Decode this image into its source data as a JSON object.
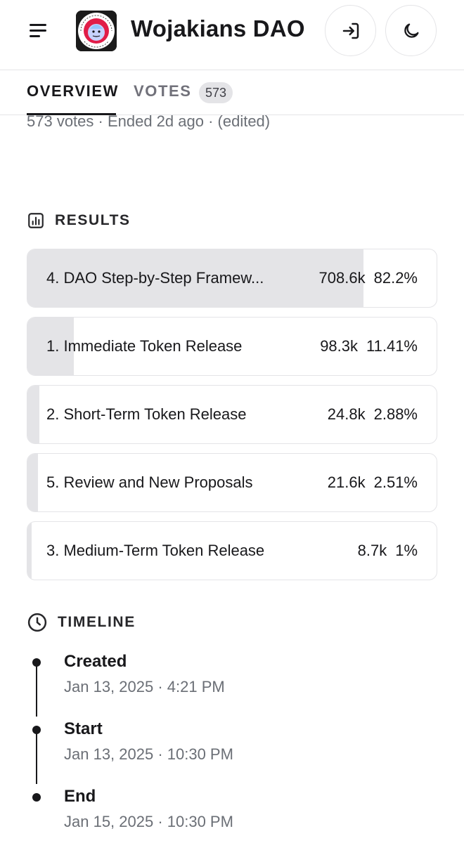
{
  "header": {
    "title": "Wojakians DAO",
    "logo_text_top": "I SUPPORT THE CURRENT",
    "logo_text_bottom": "SWOJ",
    "icons": {
      "menu": "menu-icon",
      "login": "login-icon",
      "theme": "moon-icon"
    }
  },
  "tabs": {
    "overview": "OVERVIEW",
    "votes": "VOTES",
    "votes_count": "573"
  },
  "proposal": {
    "meta": "573 votes · Ended 2d ago · (edited)"
  },
  "results": {
    "heading": "RESULTS",
    "items": [
      {
        "choice": "4. DAO Step-by-Step Framew...",
        "votes": "708.6k",
        "percent": "82.2%",
        "share": 0.822
      },
      {
        "choice": "1. Immediate Token Release",
        "votes": "98.3k",
        "percent": "11.41%",
        "share": 0.1141
      },
      {
        "choice": "2. Short-Term Token Release",
        "votes": "24.8k",
        "percent": "2.88%",
        "share": 0.0288
      },
      {
        "choice": "5. Review and New Proposals",
        "votes": "21.6k",
        "percent": "2.51%",
        "share": 0.0251
      },
      {
        "choice": "3. Medium-Term Token Release",
        "votes": "8.7k",
        "percent": "1%",
        "share": 0.01
      }
    ]
  },
  "timeline": {
    "heading": "TIMELINE",
    "events": [
      {
        "title": "Created",
        "date": "Jan 13, 2025 · 4:21 PM"
      },
      {
        "title": "Start",
        "date": "Jan 13, 2025 · 10:30 PM"
      },
      {
        "title": "End",
        "date": "Jan 15, 2025 · 10:30 PM"
      }
    ]
  }
}
